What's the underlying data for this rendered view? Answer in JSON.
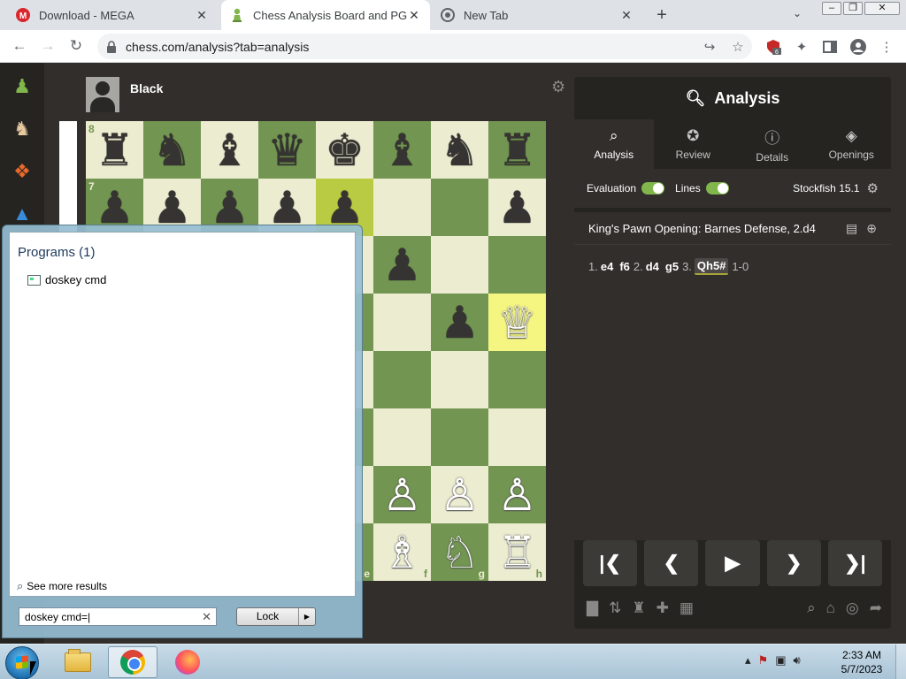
{
  "browser": {
    "tabs": [
      {
        "title": "Download - MEGA",
        "icon": "mega-icon",
        "close": "✕"
      },
      {
        "title": "Chess Analysis Board and PGN E",
        "icon": "chess-pawn-icon",
        "close": "✕"
      },
      {
        "title": "New Tab",
        "icon": "chrome-icon",
        "close": "✕"
      }
    ],
    "new_tab": "+",
    "url": "chess.com/analysis?tab=analysis",
    "extension_badge": "6"
  },
  "board": {
    "player_top": "Black",
    "ranks": [
      "8",
      "7"
    ],
    "files": [
      "e",
      "f",
      "g",
      "h"
    ]
  },
  "analysis": {
    "title": "Analysis",
    "tabs": [
      {
        "label": "Analysis",
        "icon": "analysis-magnifier-icon"
      },
      {
        "label": "Review",
        "icon": "star-icon"
      },
      {
        "label": "Details",
        "icon": "info-icon"
      },
      {
        "label": "Openings",
        "icon": "openings-book-icon"
      }
    ],
    "evaluation_label": "Evaluation",
    "lines_label": "Lines",
    "engine": "Stockfish 15.1",
    "opening": "King's Pawn Opening: Barnes Defense, 2.d4",
    "moves": {
      "n1": "1.",
      "w1": "e4",
      "b1": "f6",
      "n2": "2.",
      "w2": "d4",
      "b2": "g5",
      "n3": "3.",
      "w3": "Qh5#",
      "result": "1-0"
    }
  },
  "startmenu": {
    "group": "Programs (1)",
    "item": "doskey cmd",
    "see_more": "See more results",
    "search_value": "doskey cmd=|",
    "lock_label": "Lock"
  },
  "taskbar": {
    "time": "2:33 AM",
    "date": "5/7/2023"
  }
}
